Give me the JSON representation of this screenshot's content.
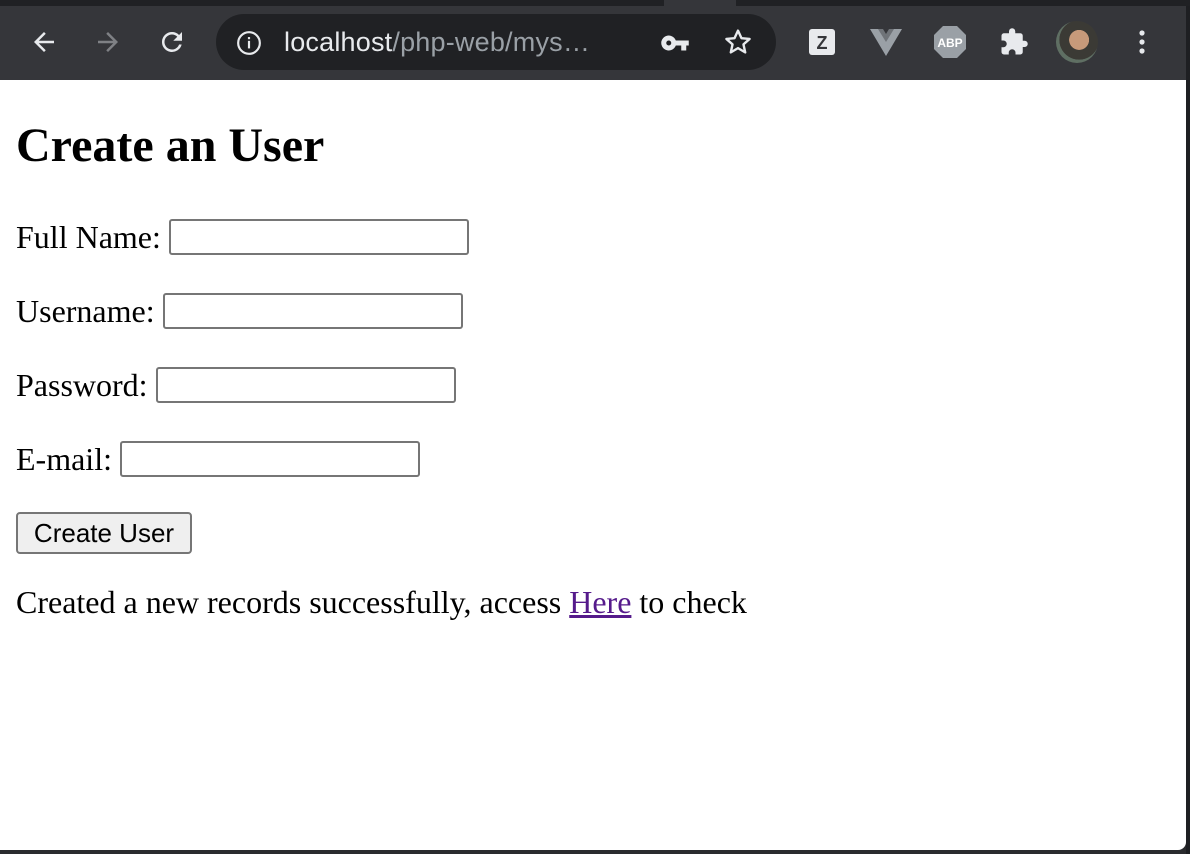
{
  "browser": {
    "url_host": "localhost",
    "url_path": "/php-web/mys…",
    "extensions": [
      "zotero-icon",
      "vue-devtools-icon",
      "adblock-plus-icon",
      "extensions-puzzle-icon"
    ],
    "abp_label": "ABP",
    "zotero_label": "Z"
  },
  "page": {
    "title": "Create an User",
    "fields": [
      {
        "label": "Full Name:",
        "value": ""
      },
      {
        "label": "Username:",
        "value": ""
      },
      {
        "label": "Password:",
        "value": ""
      },
      {
        "label": "E-mail:",
        "value": ""
      }
    ],
    "submit_label": "Create User",
    "message_before": "Created a new records successfully, access ",
    "message_link": "Here",
    "message_after": " to check"
  },
  "colors": {
    "toolbar_bg": "#35363a",
    "omnibox_bg": "#202124",
    "visited_link": "#551a8b"
  }
}
